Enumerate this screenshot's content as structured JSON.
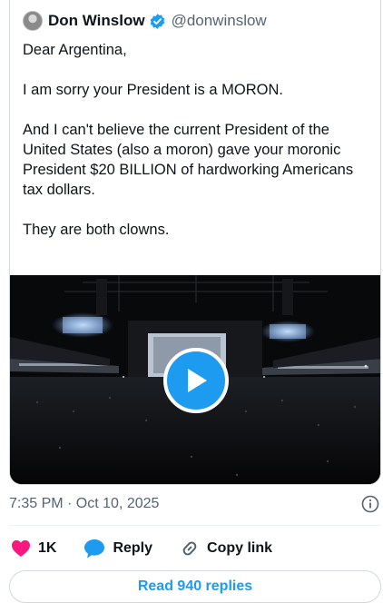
{
  "author": {
    "name": "Don Winslow",
    "handle": "@donwinslow",
    "verified": true
  },
  "tweet": {
    "paragraphs": [
      "Dear Argentina,",
      "I am sorry your President is a MORON.",
      "And I  can't believe the current President of the United States (also a moron) gave your moronic President $20 BILLION of hardworking Americans tax dollars.",
      "They are both clowns."
    ]
  },
  "media": {
    "type": "video",
    "description_icon": "play-icon"
  },
  "meta": {
    "timestamp": "7:35 PM · Oct 10, 2025"
  },
  "actions": {
    "likes": "1K",
    "reply_label": "Reply",
    "copy_link_label": "Copy link"
  },
  "replies_button": "Read 940 replies",
  "colors": {
    "accent": "#1d9bf0",
    "like": "#f91880",
    "text": "#0f1419",
    "secondary": "#536471"
  }
}
